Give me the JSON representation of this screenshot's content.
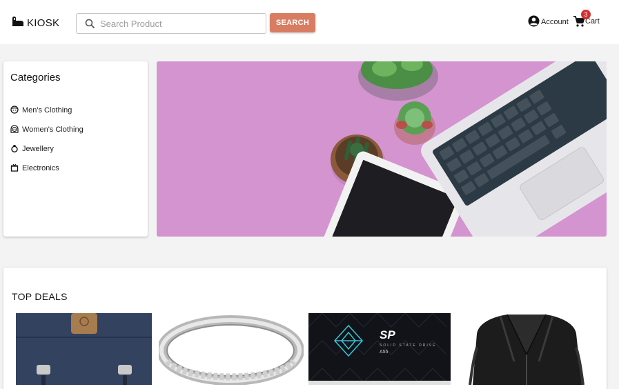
{
  "header": {
    "logo_text": "KIOSK",
    "search_placeholder": "Search Product",
    "search_value": "",
    "search_button": "SEARCH",
    "account_label": "Account",
    "cart_label": "Cart",
    "cart_count": "3"
  },
  "categories": {
    "title": "Categories",
    "items": [
      {
        "label": "Men's Clothing",
        "icon": "face-icon"
      },
      {
        "label": "Women's Clothing",
        "icon": "face-female-icon"
      },
      {
        "label": "Jewellery",
        "icon": "ring-icon"
      },
      {
        "label": "Electronics",
        "icon": "tv-icon"
      }
    ]
  },
  "deals": {
    "title": "TOP DEALS",
    "items": [
      {
        "name": "backpack"
      },
      {
        "name": "ring"
      },
      {
        "name": "solid state drive"
      },
      {
        "name": "leather jacket"
      }
    ],
    "ssd_brand": "SP",
    "ssd_model": "A55",
    "ssd_caption": "SOLID STATE DRIVE"
  },
  "colors": {
    "accent": "#d87d62",
    "banner": "#d494d0",
    "badge": "#d32f2f"
  }
}
